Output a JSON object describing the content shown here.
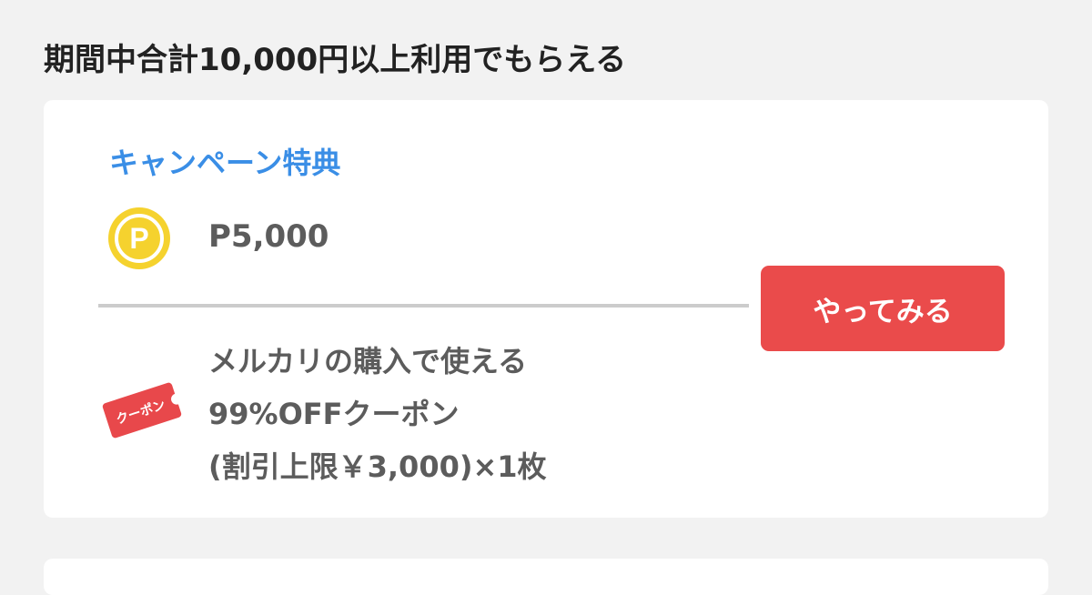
{
  "section": {
    "title": "期間中合計10,000円以上利用でもらえる"
  },
  "card": {
    "label": "キャンペーン特典",
    "point": {
      "icon": "point-coin-icon",
      "icon_letter": "P",
      "amount": "P5,000"
    },
    "coupon": {
      "icon": "coupon-ticket-icon",
      "icon_label": "クーポン",
      "lines": [
        "メルカリの購入で使える",
        "99%OFFクーポン",
        "(割引上限￥3,000)×1枚"
      ]
    },
    "button_label": "やってみる"
  },
  "colors": {
    "accent_blue": "#3a8ee6",
    "button_red": "#ea4b4b",
    "coin_yellow": "#f5d22e",
    "coupon_red": "#e8484b"
  }
}
